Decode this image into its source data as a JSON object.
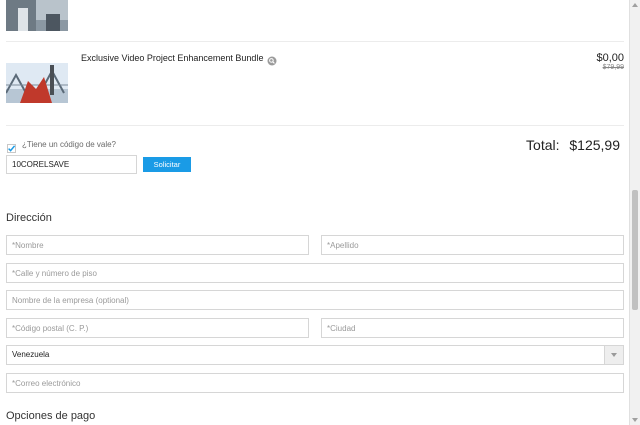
{
  "cart": {
    "items": [
      {
        "name": "Exclusive Video Project Enhancement Bundle",
        "price": "$0,00",
        "original_price": "$79,99",
        "info_icon": "magnifier-info-icon"
      }
    ]
  },
  "voucher": {
    "checkbox_label": "¿Tiene un código de vale?",
    "checked": true,
    "code_value": "10CORELSAVE",
    "apply_label": "Solicitar"
  },
  "total": {
    "label": "Total:",
    "amount": "$125,99"
  },
  "address": {
    "title": "Dirección",
    "first_name_placeholder": "*Nombre",
    "last_name_placeholder": "*Apellido",
    "street_placeholder": "*Calle y número de piso",
    "company_placeholder": "Nombre de la empresa (optional)",
    "postal_placeholder": "*Código postal (C. P.)",
    "city_placeholder": "*Ciudad",
    "country_value": "Venezuela",
    "email_placeholder": "*Correo electrónico"
  },
  "payment": {
    "title": "Opciones de pago"
  },
  "colors": {
    "accent": "#1a9be6",
    "checkbox": "#1a9be6"
  }
}
